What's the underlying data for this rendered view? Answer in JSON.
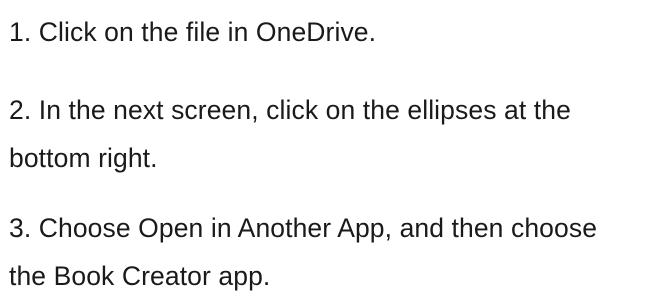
{
  "instructions": {
    "steps": [
      {
        "text": "1. Click on the file in OneDrive."
      },
      {
        "text": "2. In the next screen, click on the ellipses at the bottom right."
      },
      {
        "text": "3. Choose Open in Another App, and then choose the Book Creator app."
      }
    ]
  }
}
